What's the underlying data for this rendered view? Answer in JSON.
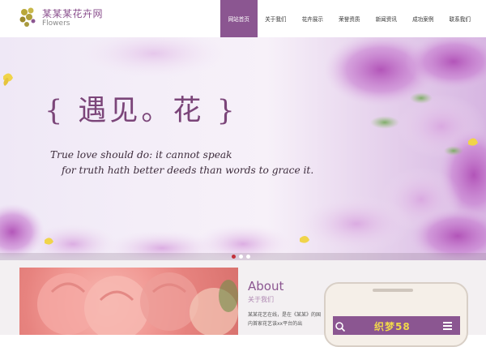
{
  "brand": {
    "name": "某某某花卉网",
    "sub": "Flowers"
  },
  "nav": [
    "网站首页",
    "关于我们",
    "花卉展示",
    "荣誉资质",
    "新闻资讯",
    "成功案例",
    "联系我们"
  ],
  "banner": {
    "slogan": "{ 遇见。花 }",
    "quote_line1": "True love should do: it cannot speak",
    "quote_line2": "for truth hath better deeds than words to grace it.",
    "slides": 3,
    "active_slide": 1
  },
  "about": {
    "title": "About",
    "subtitle": "关于我们",
    "text": "某某花艺在线，是在《某某》的国内首家花艺该xx平台的出"
  },
  "phone": {
    "title": "织梦58"
  },
  "colors": {
    "accent": "#8b5691",
    "active_dot": "#c2313b"
  }
}
